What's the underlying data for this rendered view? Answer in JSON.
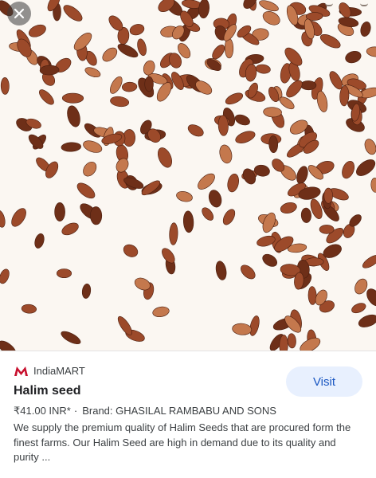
{
  "image": {
    "subject": "seeds-photo",
    "colors": {
      "background": "#fbf7f2",
      "seed_dark": "#6e2f18",
      "seed_mid": "#9c4a2a",
      "seed_light": "#c4784d"
    }
  },
  "controls": {
    "close_icon": "close-icon",
    "top_right_icons": [
      "expand-icon",
      "more-icon"
    ]
  },
  "result": {
    "source": "IndiaMART",
    "title": "Halim seed",
    "price": "₹41.00 INR*",
    "separator": "·",
    "brand": "Brand: GHASILAL RAMBABU AND SONS",
    "description": "We supply the premium quality of Halim Seeds that are procured form the finest farms. Our Halim Seed are high in demand due to its quality and purity ...",
    "visit_label": "Visit"
  },
  "colors": {
    "visit_bg": "#e8f0fe",
    "visit_text": "#1a57c2",
    "logo_red": "#c8102e"
  }
}
